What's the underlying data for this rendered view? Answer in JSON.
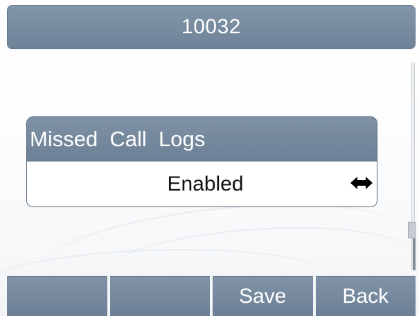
{
  "title_bar": {
    "title": "10032"
  },
  "setting": {
    "label": "Missed  Call  Logs",
    "value": "Enabled",
    "toggle_icon": "left-right-arrows-icon"
  },
  "softkeys": [
    {
      "label": ""
    },
    {
      "label": ""
    },
    {
      "label": "Save"
    },
    {
      "label": "Back"
    }
  ],
  "colors": {
    "bar_background": "#7589a0",
    "border": "#4f6074",
    "text_light": "#ffffff",
    "text_dark": "#111111"
  }
}
